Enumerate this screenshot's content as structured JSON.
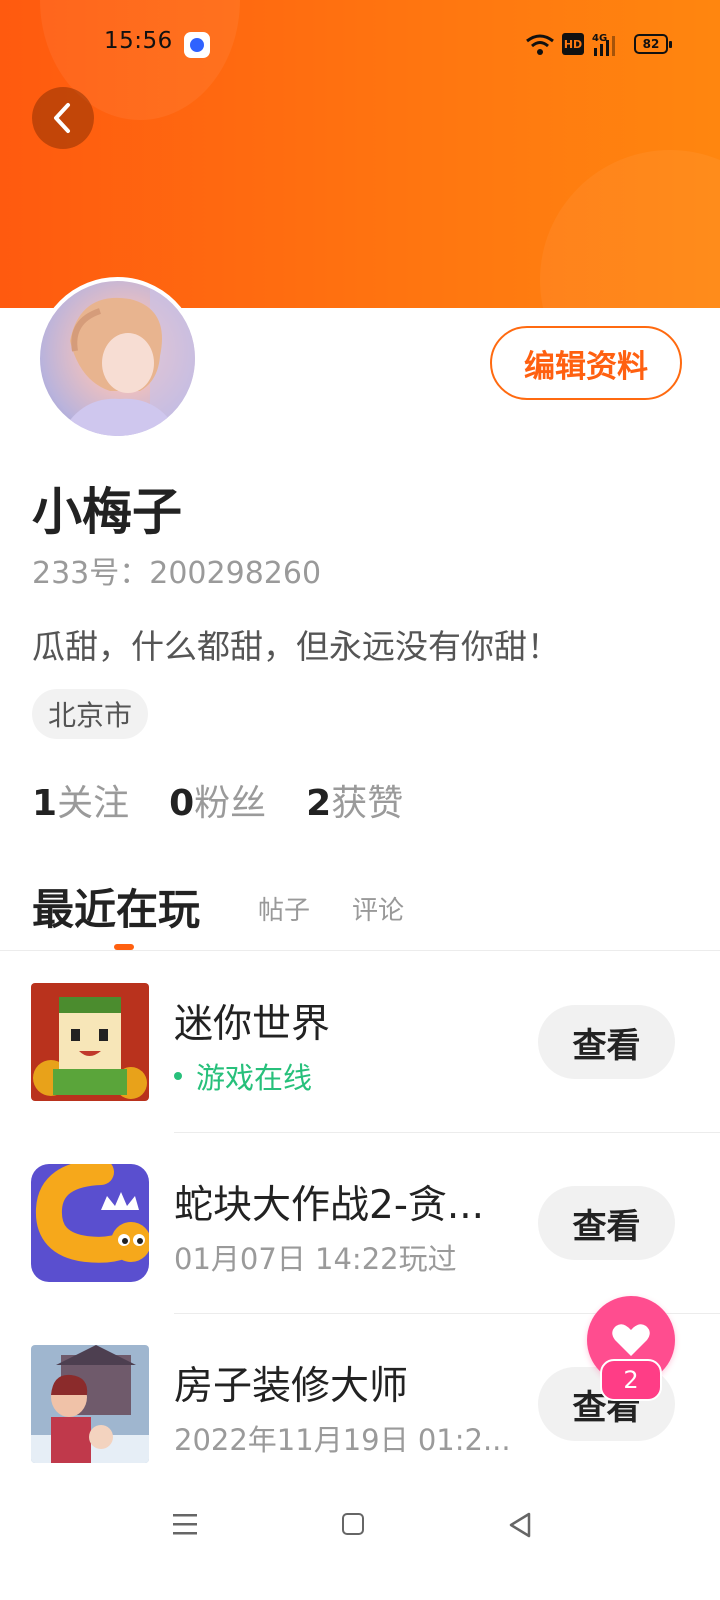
{
  "status_bar": {
    "time": "15:56",
    "network": "4G",
    "hd": "HD",
    "battery": "82"
  },
  "profile": {
    "name": "小梅子",
    "id_text": "233号：200298260",
    "bio": "瓜甜，什么都甜，但永远没有你甜！",
    "location": "北京市",
    "edit_label": "编辑资料"
  },
  "stats": [
    {
      "value": "1",
      "label": "关注"
    },
    {
      "value": "0",
      "label": "粉丝"
    },
    {
      "value": "2",
      "label": "获赞"
    }
  ],
  "tabs": [
    {
      "label": "最近在玩"
    },
    {
      "label": "帖子"
    },
    {
      "label": "评论"
    }
  ],
  "games": [
    {
      "title": "迷你世界",
      "subtitle": "游戏在线",
      "online": true,
      "button": "查看"
    },
    {
      "title": "蛇块大作战2-贪...",
      "subtitle": "01月07日 14:22玩过",
      "online": false,
      "button": "查看"
    },
    {
      "title": "房子装修大师",
      "subtitle": "2022年11月19日 01:2...",
      "online": false,
      "button": "查看"
    }
  ],
  "like_fab": {
    "count": "2"
  },
  "colors": {
    "brand_orange": "#ff6a10",
    "online_green": "#27c07b",
    "like_pink": "#ff4d8f"
  }
}
